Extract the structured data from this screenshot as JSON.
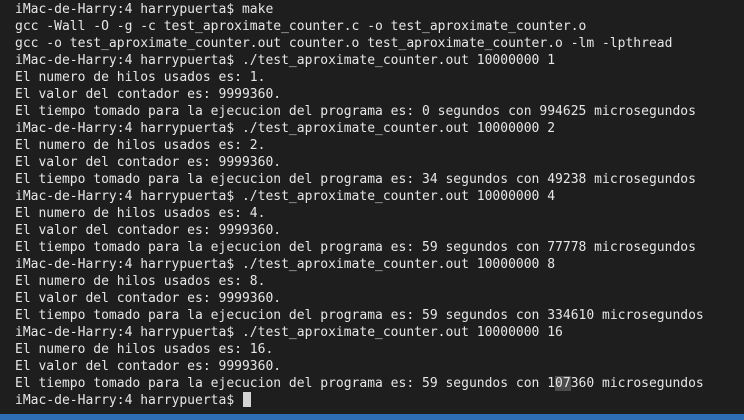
{
  "terminal": {
    "lines": [
      "iMac-de-Harry:4 harrypuerta$ make",
      "gcc -Wall -O -g -c test_aproximate_counter.c -o test_aproximate_counter.o",
      "gcc -o test_aproximate_counter.out counter.o test_aproximate_counter.o -lm -lpthread",
      "iMac-de-Harry:4 harrypuerta$ ./test_aproximate_counter.out 10000000 1",
      "El numero de hilos usados es: 1.",
      "El valor del contador es: 9999360.",
      "El tiempo tomado para la ejecucion del programa es: 0 segundos con 994625 microsegundos",
      "iMac-de-Harry:4 harrypuerta$ ./test_aproximate_counter.out 10000000 2",
      "El numero de hilos usados es: 2.",
      "El valor del contador es: 9999360.",
      "El tiempo tomado para la ejecucion del programa es: 34 segundos con 49238 microsegundos",
      "iMac-de-Harry:4 harrypuerta$ ./test_aproximate_counter.out 10000000 4",
      "El numero de hilos usados es: 4.",
      "El valor del contador es: 9999360.",
      "El tiempo tomado para la ejecucion del programa es: 59 segundos con 77778 microsegundos",
      "iMac-de-Harry:4 harrypuerta$ ./test_aproximate_counter.out 10000000 8",
      "El numero de hilos usados es: 8.",
      "El valor del contador es: 9999360.",
      "El tiempo tomado para la ejecucion del programa es: 59 segundos con 334610 microsegundos",
      "iMac-de-Harry:4 harrypuerta$ ./test_aproximate_counter.out 10000000 16",
      "El numero de hilos usados es: 16.",
      "El valor del contador es: 9999360."
    ],
    "highlighted_line": {
      "before": "El tiempo tomado para la ejecucion del programa es: 59 segundos con 1",
      "selected": "07",
      "after": "360 microsegundos"
    },
    "prompt": "iMac-de-Harry:4 harrypuerta$ ",
    "colors": {
      "background": "#1e1e1e",
      "text": "#e6e6e6",
      "cursor": "#d4d4d4",
      "selection": "#4b4b4b",
      "status_bar": "#2e6eb6"
    }
  }
}
